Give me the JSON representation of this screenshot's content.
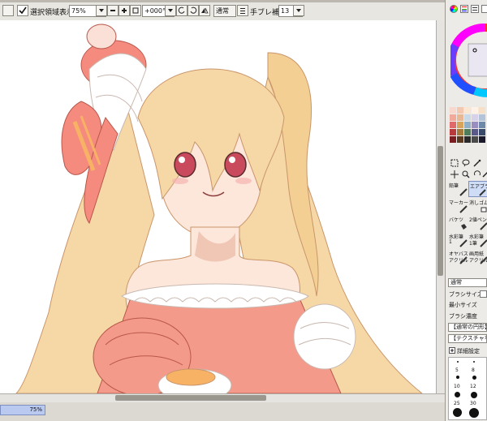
{
  "toolbar": {
    "selection_checkbox_label": "選択領域表示",
    "selection_checked": true,
    "zoom_value": "75%",
    "rotation_value": "+000°",
    "blend_mode": "通常",
    "stabilizer_label": "手ブレ補正",
    "stabilizer_value": "13"
  },
  "status": {
    "zoom_text": "75%",
    "zoom_fill_percent": 100
  },
  "right_panel": {
    "tool_labels": [
      "鉛筆",
      "エアブラシ",
      "マーカー",
      "消しゴム",
      "バケツ",
      "2値ペン",
      "水彩筆",
      "水彩筆",
      "オヤバス",
      "画用紙"
    ],
    "tool_sub_labels": [
      "1",
      "1筆",
      "アクリル",
      "アクリル"
    ],
    "blend_mode": "通常",
    "brush_size_label": "ブラシサイズ",
    "min_size_label": "最小サイズ",
    "brush_density_label": "ブラシ濃度",
    "shape_value": "【通常の円形】",
    "texture_value": "【テクスチャなし】",
    "advanced_label": "詳細設定",
    "size_labels": [
      "5",
      "8",
      "10",
      "12",
      "25",
      "30"
    ]
  },
  "colors": {
    "hair": "#f6d8a6",
    "ribbon": "#f48b7e",
    "skin": "#fde6da",
    "dress": "#f49a8a",
    "selection_blue": "#b9c9ef"
  }
}
